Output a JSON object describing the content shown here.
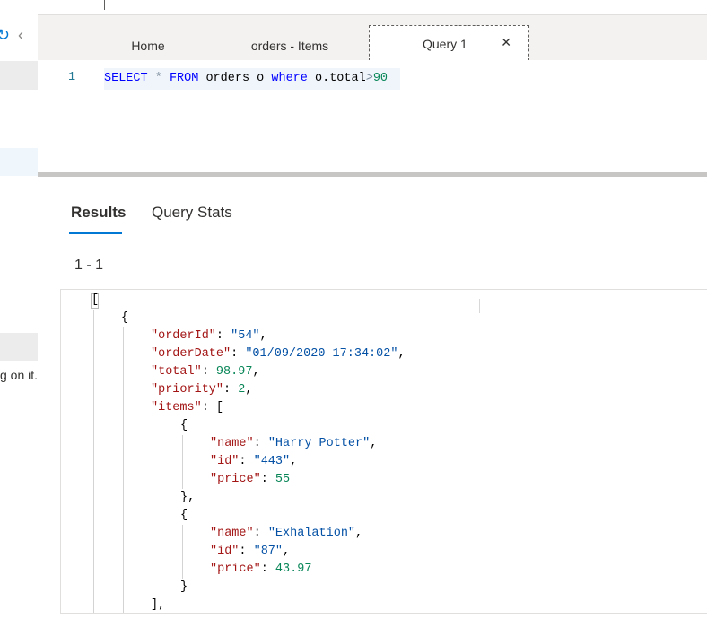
{
  "sidebar": {
    "refresh_icon": "refresh-icon",
    "collapse_icon": "chevron-left-icon",
    "partial_text": "g on it."
  },
  "tabs": [
    {
      "label": "Home"
    },
    {
      "label": "orders - Items"
    },
    {
      "label": "Query 1",
      "close": "✕"
    }
  ],
  "editor": {
    "line_number": "1",
    "tokens": {
      "select": "SELECT",
      "star": "*",
      "from": "FROM",
      "table": "orders o",
      "where": "where",
      "field": "o.total",
      "gt": ">",
      "value": "90"
    }
  },
  "results": {
    "tabs": [
      {
        "label": "Results"
      },
      {
        "label": "Query Stats"
      }
    ],
    "range": "1 - 1",
    "json": {
      "open_array": "[",
      "open_obj": "{",
      "orderId_key": "\"orderId\"",
      "orderId_val": "\"54\"",
      "orderDate_key": "\"orderDate\"",
      "orderDate_val": "\"01/09/2020 17:34:02\"",
      "total_key": "\"total\"",
      "total_val": "98.97",
      "priority_key": "\"priority\"",
      "priority_val": "2",
      "items_key": "\"items\"",
      "items": [
        {
          "name_key": "\"name\"",
          "name_val": "\"Harry Potter\"",
          "id_key": "\"id\"",
          "id_val": "\"443\"",
          "price_key": "\"price\"",
          "price_val": "55"
        },
        {
          "name_key": "\"name\"",
          "name_val": "\"Exhalation\"",
          "id_key": "\"id\"",
          "id_val": "\"87\"",
          "price_key": "\"price\"",
          "price_val": "43.97"
        }
      ]
    }
  },
  "colors": {
    "accent": "#0078d4",
    "keyword": "#0000ff",
    "json_key": "#a31515",
    "json_string": "#0451a5",
    "json_number": "#098658"
  }
}
